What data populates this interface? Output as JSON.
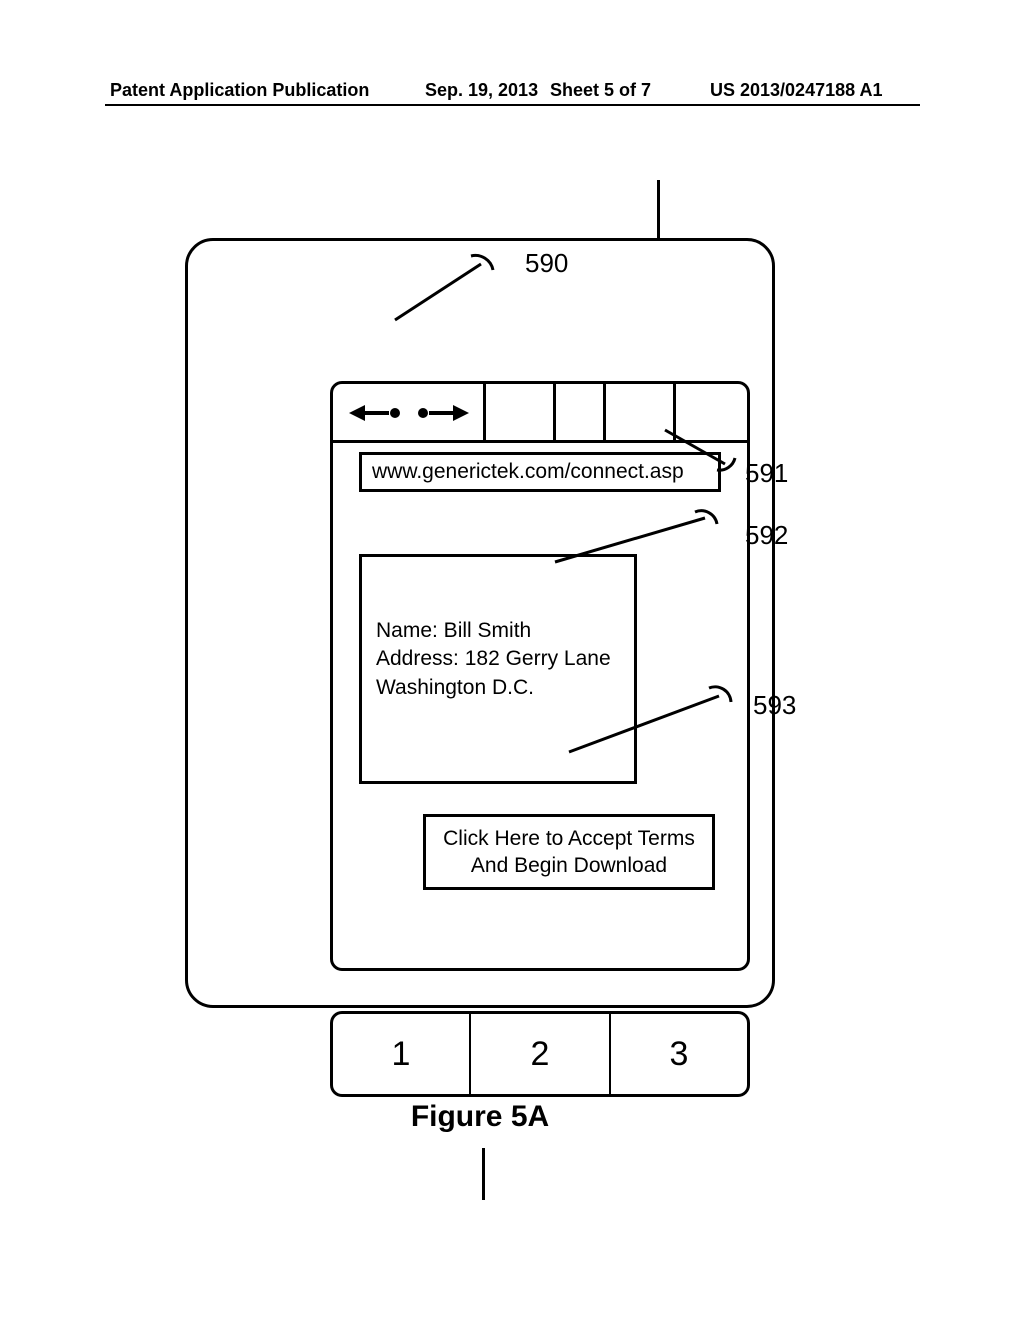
{
  "header": {
    "publication_type": "Patent Application Publication",
    "date": "Sep. 19, 2013",
    "sheet": "Sheet 5 of 7",
    "pub_number": "US 2013/0247188 A1"
  },
  "refs": {
    "r590": "590",
    "r591": "591",
    "r592": "592",
    "r593": "593"
  },
  "browser": {
    "url": "www.generictek.com/connect.asp",
    "form": {
      "line1": "Name: Bill Smith",
      "line2": "Address: 182 Gerry Lane",
      "line3": "Washington D.C."
    },
    "download_button": "Click Here to Accept Terms And Begin Download"
  },
  "keys": {
    "k1": "1",
    "k2": "2",
    "k3": "3"
  },
  "caption": "Figure 5A"
}
